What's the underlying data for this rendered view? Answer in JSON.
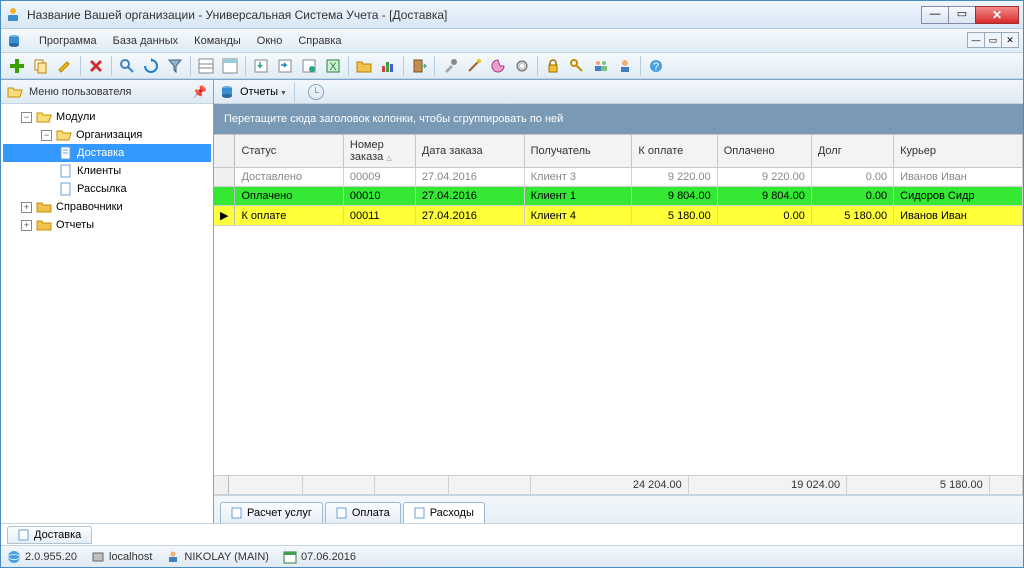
{
  "window": {
    "title": "Название Вашей организации - Универсальная Система Учета - [Доставка]"
  },
  "menu": [
    "Программа",
    "База данных",
    "Команды",
    "Окно",
    "Справка"
  ],
  "sidebar": {
    "title": "Меню пользователя",
    "nodes": {
      "modules": "Модули",
      "org": "Организация",
      "delivery": "Доставка",
      "clients": "Клиенты",
      "mailing": "Рассылка",
      "catalogs": "Справочники",
      "reports": "Отчеты"
    }
  },
  "reportbar": {
    "label": "Отчеты"
  },
  "groupzone": "Перетащите сюда заголовок колонки, чтобы сгруппировать по ней",
  "columns": {
    "status": "Статус",
    "number": "Номер заказа",
    "date": "Дата заказа",
    "recipient": "Получатель",
    "topay": "К оплате",
    "paid": "Оплачено",
    "debt": "Долг",
    "courier": "Курьер"
  },
  "rows": [
    {
      "status": "Доставлено",
      "number": "00009",
      "date": "27.04.2016",
      "recipient": "Клиент 3",
      "topay": "9 220.00",
      "paid": "9 220.00",
      "debt": "0.00",
      "courier": "Иванов Иван",
      "cls": "r-gray"
    },
    {
      "status": "Оплачено",
      "number": "00010",
      "date": "27.04.2016",
      "recipient": "Клиент 1",
      "topay": "9 804.00",
      "paid": "9 804.00",
      "debt": "0.00",
      "courier": "Сидоров Сидр",
      "cls": "r-green"
    },
    {
      "status": "К оплате",
      "number": "00011",
      "date": "27.04.2016",
      "recipient": "Клиент 4",
      "topay": "5 180.00",
      "paid": "0.00",
      "debt": "5 180.00",
      "courier": "Иванов Иван",
      "cls": "r-yellow",
      "current": true
    }
  ],
  "totals": {
    "topay": "24 204.00",
    "paid": "19 024.00",
    "debt": "5 180.00"
  },
  "tabs": {
    "t1": "Расчет услуг",
    "t2": "Оплата",
    "t3": "Расходы"
  },
  "bottom_tab": "Доставка",
  "status": {
    "version": "2.0.955.20",
    "host": "localhost",
    "user": "NIKOLAY (MAIN)",
    "date": "07.06.2016"
  }
}
